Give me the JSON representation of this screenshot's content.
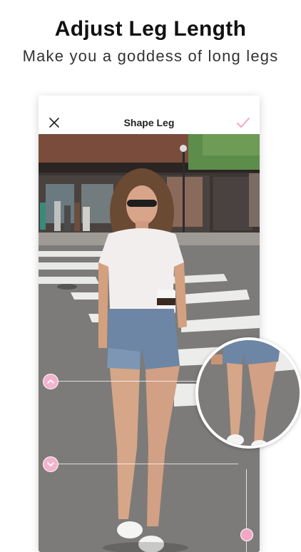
{
  "promo": {
    "title": "Adjust Leg Length",
    "subtitle": "Make you a goddess of long legs"
  },
  "editor": {
    "title": "Shape Leg",
    "close_icon": "close-icon",
    "confirm_icon": "checkmark-icon"
  },
  "controls": {
    "upper_handle_icon": "chevron-up-icon",
    "lower_handle_icon": "chevron-down-icon",
    "slider_knob": "length-slider-knob"
  },
  "colors": {
    "accent": "#f2a7c4",
    "title_text": "#111111"
  }
}
